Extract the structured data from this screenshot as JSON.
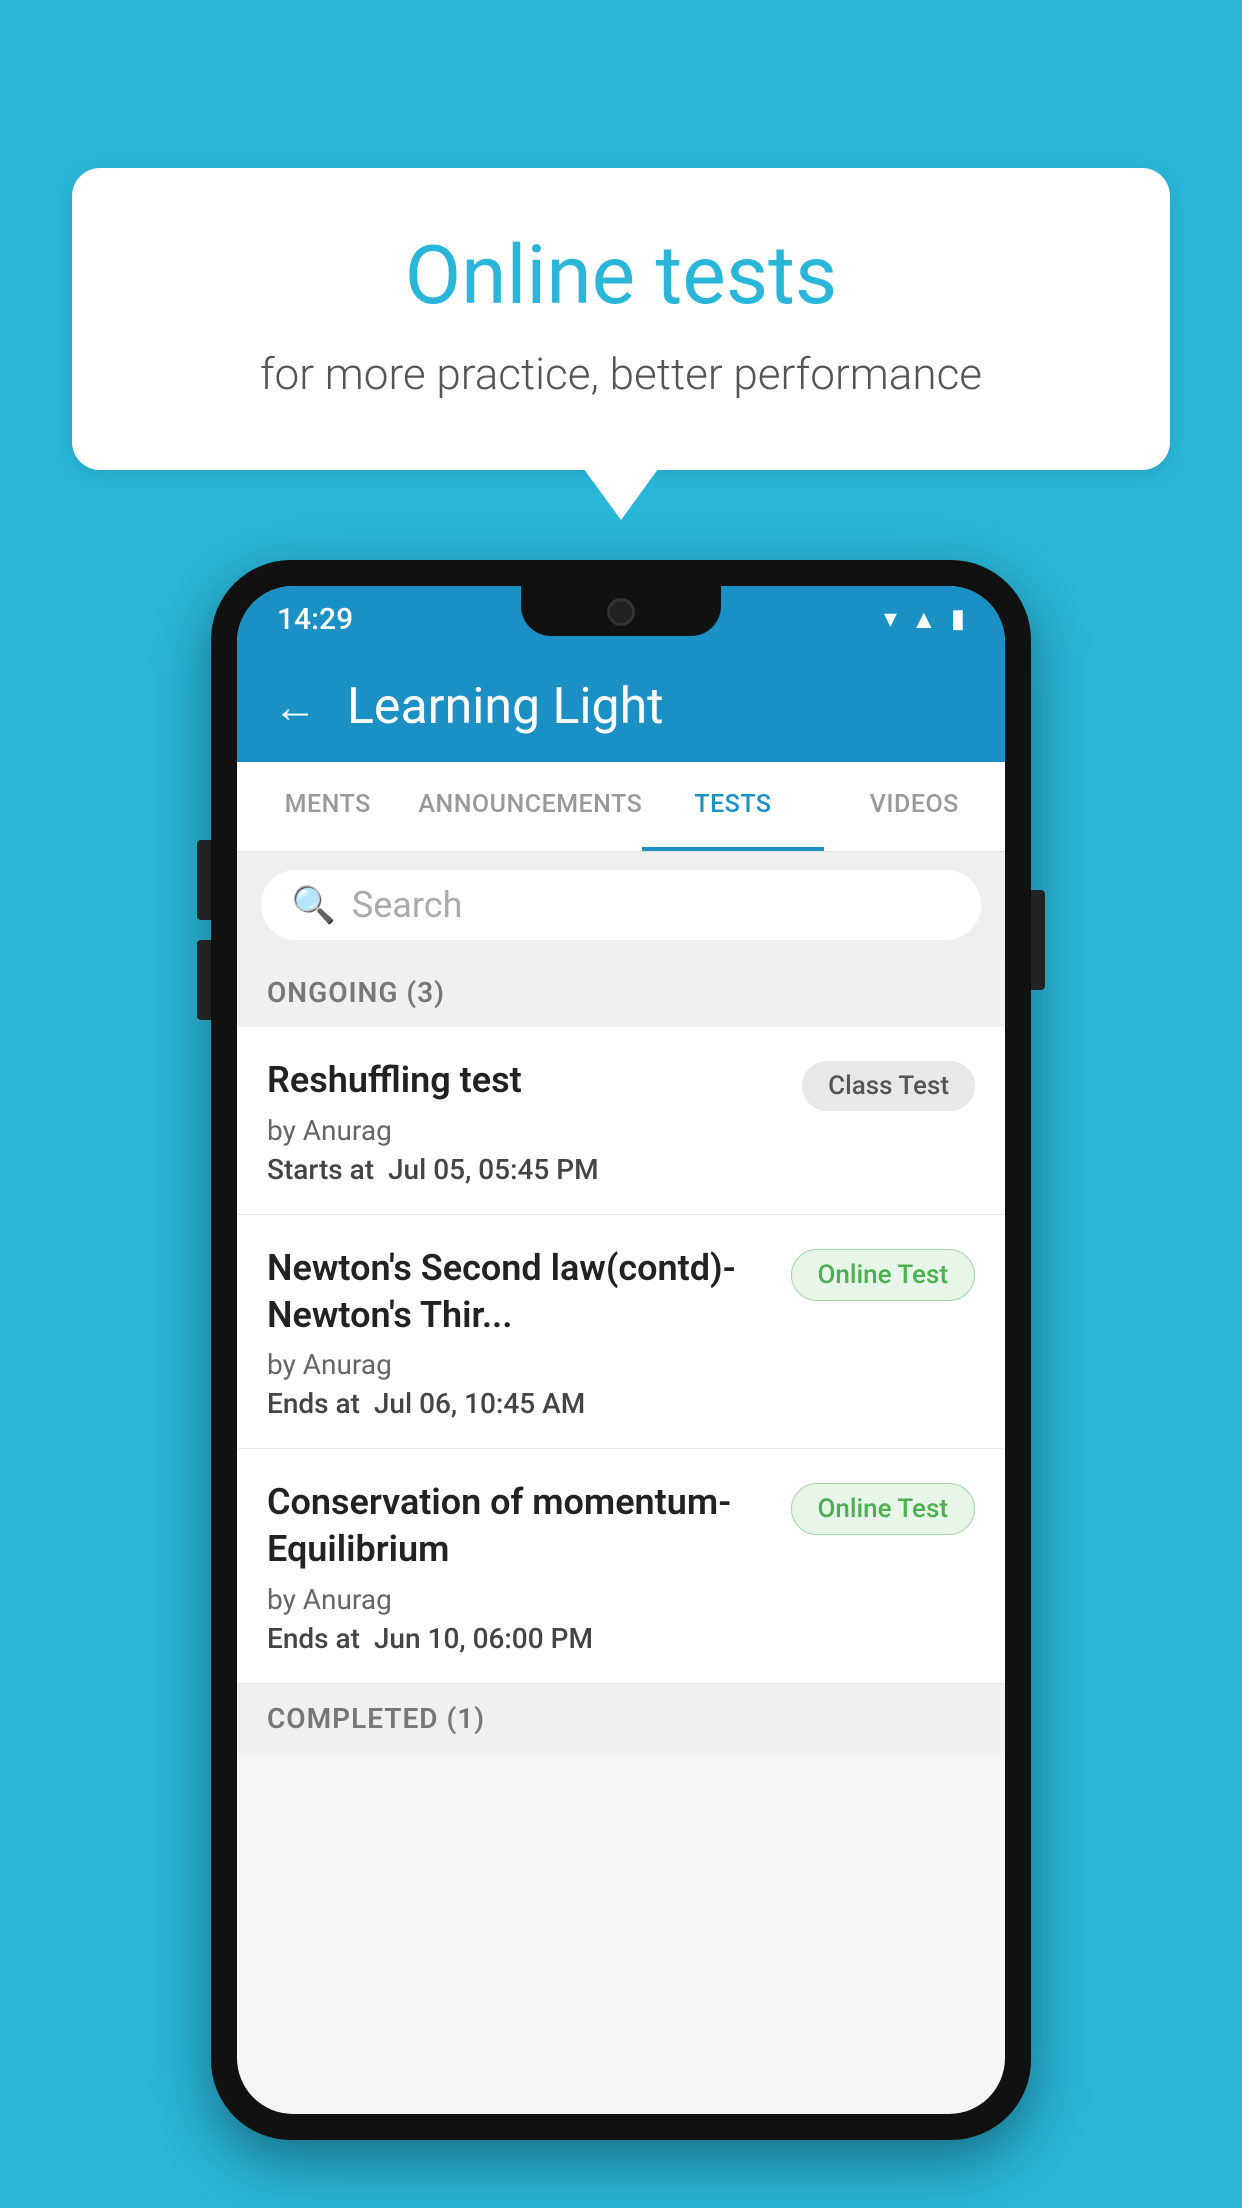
{
  "background": {
    "color": "#29b6d8"
  },
  "bubble": {
    "title": "Online tests",
    "subtitle": "for more practice, better performance"
  },
  "phone": {
    "status_bar": {
      "time": "14:29",
      "icons": [
        "wifi",
        "signal",
        "battery"
      ]
    },
    "header": {
      "back_label": "←",
      "title": "Learning Light"
    },
    "tabs": [
      {
        "label": "MENTS",
        "active": false
      },
      {
        "label": "ANNOUNCEMENTS",
        "active": false
      },
      {
        "label": "TESTS",
        "active": true
      },
      {
        "label": "VIDEOS",
        "active": false
      }
    ],
    "search": {
      "placeholder": "Search"
    },
    "ongoing_section": {
      "title": "ONGOING (3)"
    },
    "tests": [
      {
        "name": "Reshuffling test",
        "by": "by Anurag",
        "date_label": "Starts at",
        "date_value": "Jul 05, 05:45 PM",
        "badge": "Class Test",
        "badge_type": "class"
      },
      {
        "name": "Newton's Second law(contd)-Newton's Thir...",
        "by": "by Anurag",
        "date_label": "Ends at",
        "date_value": "Jul 06, 10:45 AM",
        "badge": "Online Test",
        "badge_type": "online"
      },
      {
        "name": "Conservation of momentum-Equilibrium",
        "by": "by Anurag",
        "date_label": "Ends at",
        "date_value": "Jun 10, 06:00 PM",
        "badge": "Online Test",
        "badge_type": "online"
      }
    ],
    "completed_section": {
      "title": "COMPLETED (1)"
    }
  }
}
